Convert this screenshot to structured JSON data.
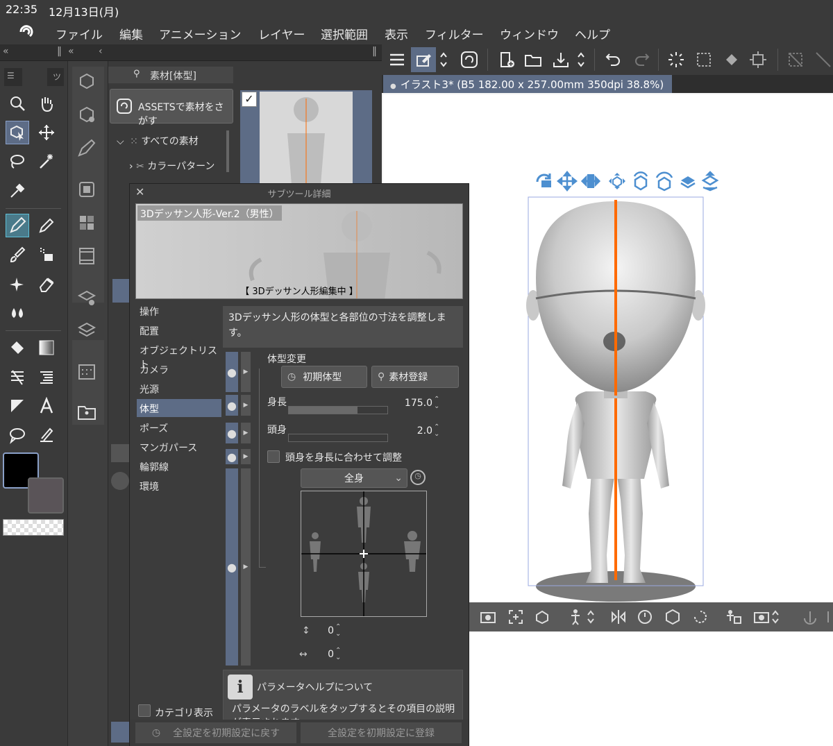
{
  "status": {
    "time": "22:35",
    "date": "12月13日(月)"
  },
  "menu": [
    "ファイル",
    "編集",
    "アニメーション",
    "レイヤー",
    "選択範囲",
    "表示",
    "フィルター",
    "ウィンドウ",
    "ヘルプ"
  ],
  "document_tab": "イラスト3* (B5 182.00 x 257.00mm 350dpi 38.8%)",
  "material_panel": {
    "title": "素材[体型]",
    "assets_button": "ASSETSで素材をさがす",
    "tree": [
      "すべての素材",
      "カラーパターン"
    ]
  },
  "dialog": {
    "title": "サブツール詳細",
    "preview_name": "3Dデッサン人形-Ver.2（男性）",
    "preview_status": "【 3Dデッサン人形編集中 】",
    "categories": [
      "操作",
      "配置",
      "オブジェクトリスト",
      "カメラ",
      "光源",
      "体型",
      "ポーズ",
      "マンガパース",
      "輪郭線",
      "環境"
    ],
    "active_category": "体型",
    "description": "3Dデッサン人形の体型と各部位の寸法を調整します。",
    "section_label": "体型変更",
    "initial_body_button": "初期体型",
    "register_button": "素材登録",
    "height": {
      "label": "身長",
      "value": "175.0",
      "fill": 0.7
    },
    "head_ratio": {
      "label": "頭身",
      "value": "2.0",
      "fill": 0.0
    },
    "adjust_checkbox": "頭身を身長に合わせて調整",
    "body_part_select": "全身",
    "vertical_value": "0",
    "horizontal_value": "0",
    "help_title": "パラメータヘルプについて",
    "help_text": "パラメータのラベルをタップするとその項目の説明が表示されます。",
    "category_display": "カテゴリ表示",
    "reset_button": "全設定を初期設定に戻す",
    "save_default_button": "全設定を初期設定に登録"
  },
  "colors": {
    "accent": "#5d6c86",
    "panel": "#3a3a3a",
    "highlight_icon": "#4d8fd0",
    "center_line": "#ff6a00"
  }
}
